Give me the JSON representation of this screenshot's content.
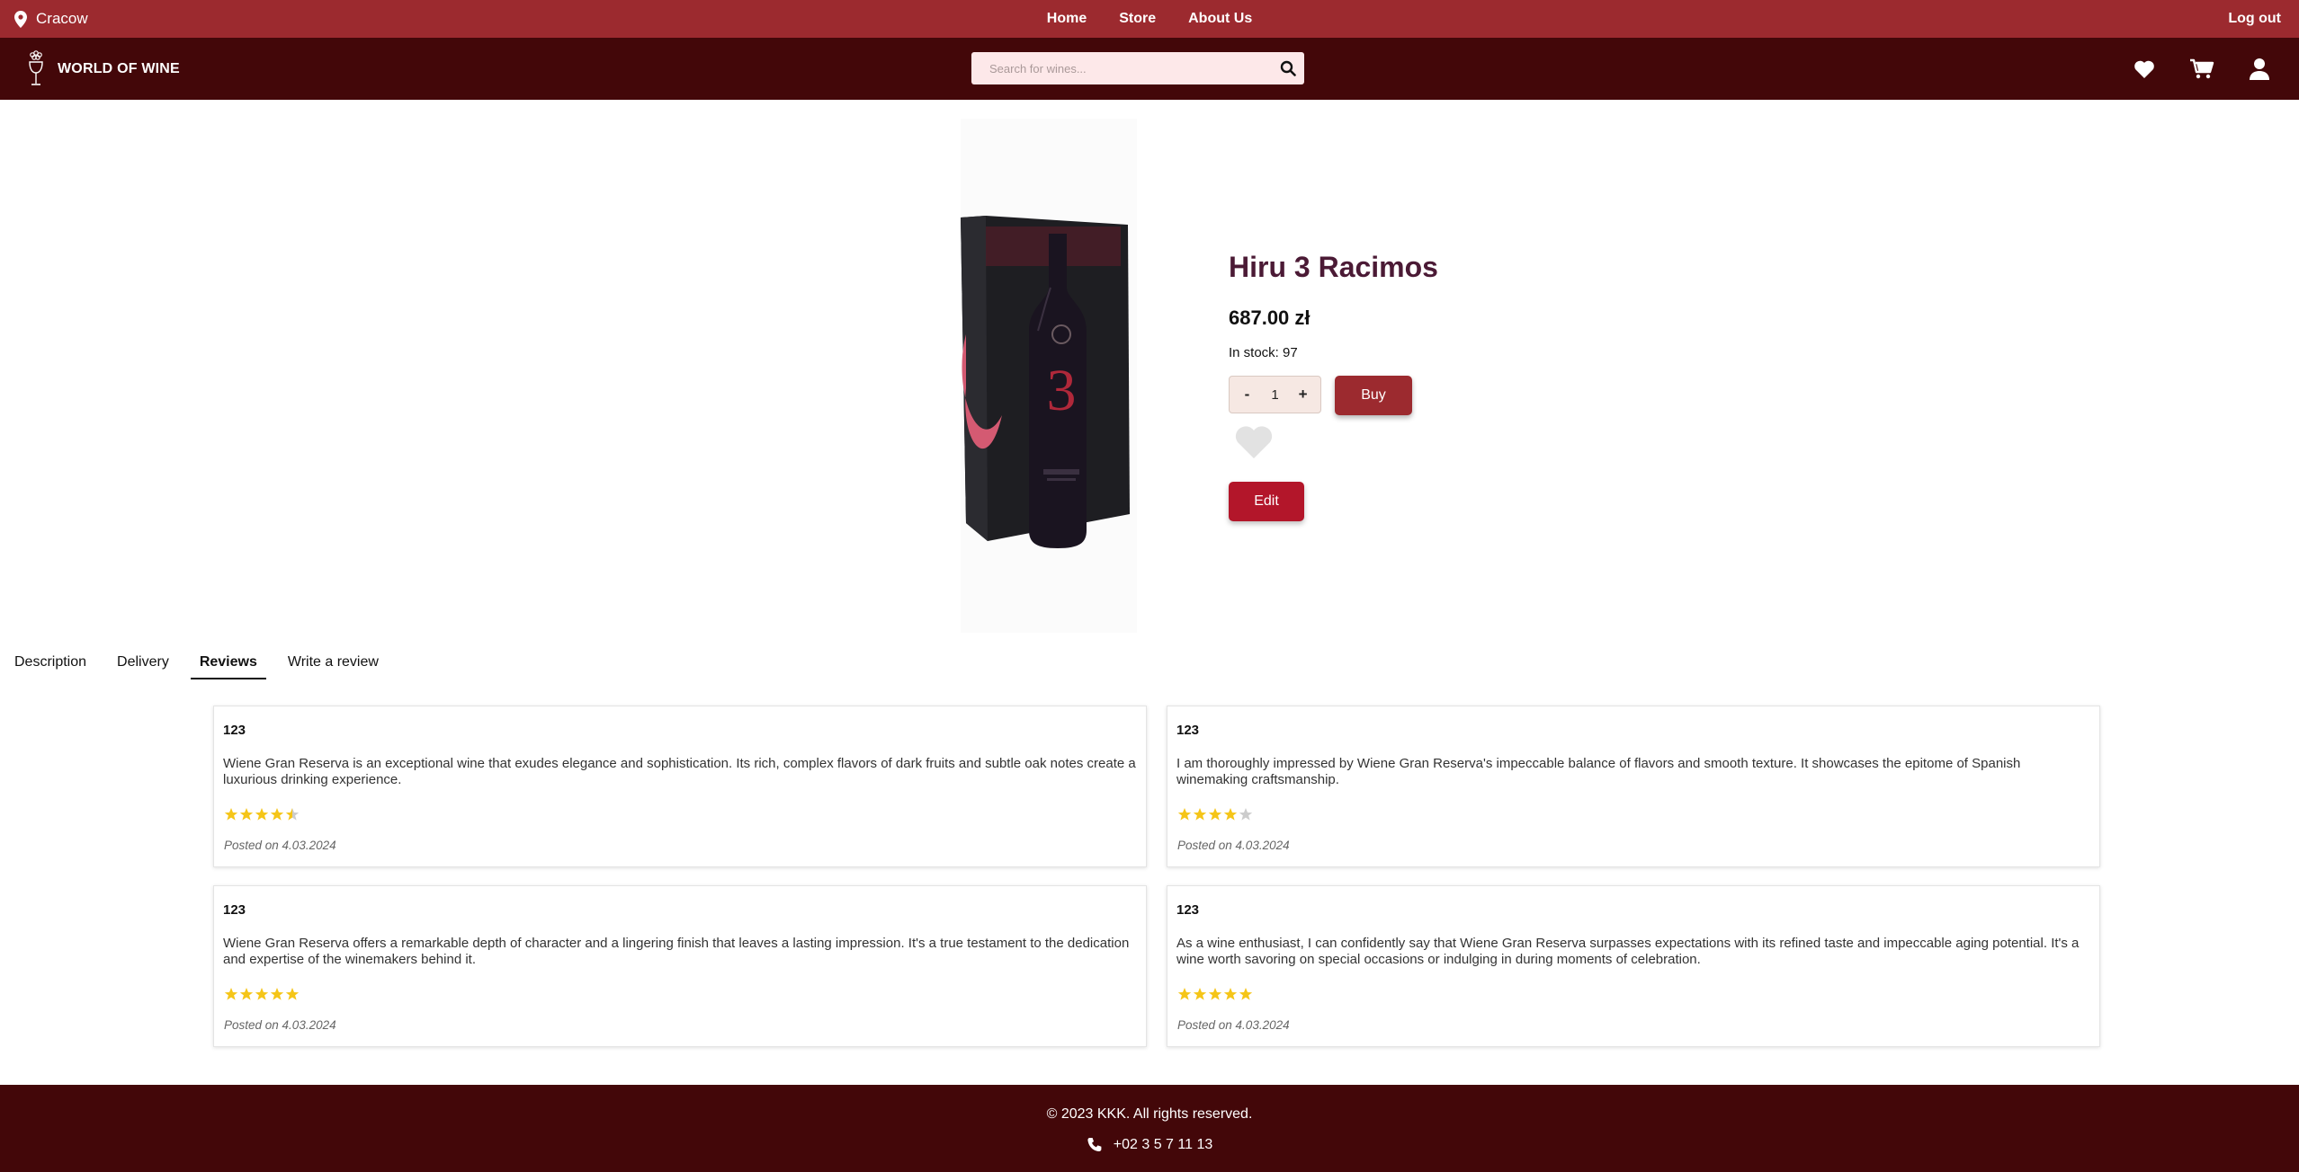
{
  "topbar": {
    "location": "Cracow",
    "location_icon": "map-pin-icon",
    "nav": [
      "Home",
      "Store",
      "About Us"
    ],
    "logout": "Log out",
    "color": "#9c2a2f"
  },
  "header": {
    "brand": "WORLD OF WINE",
    "search_placeholder": "Search for wines...",
    "icons": [
      "heart-icon",
      "cart-icon",
      "user-icon"
    ],
    "color": "#430709"
  },
  "product": {
    "name": "Hiru 3 Racimos",
    "price": "687.00 zł",
    "stock": "In stock: 97",
    "quantity": "1",
    "decrement": "-",
    "increment": "+",
    "buy_label": "Buy",
    "edit_label": "Edit"
  },
  "tabs": [
    {
      "label": "Description",
      "active": false
    },
    {
      "label": "Delivery",
      "active": false
    },
    {
      "label": "Reviews",
      "active": true
    },
    {
      "label": "Write a review",
      "active": false
    }
  ],
  "reviews": [
    {
      "author": "123",
      "text": "Wiene Gran Reserva is an exceptional wine that exudes elegance and sophistication. Its rich, complex flavors of dark fruits and subtle oak notes create a luxurious drinking experience.",
      "rating": 4.5,
      "date": "Posted on 4.03.2024"
    },
    {
      "author": "123",
      "text": "I am thoroughly impressed by Wiene Gran Reserva's impeccable balance of flavors and smooth texture. It showcases the epitome of Spanish winemaking craftsmanship.",
      "rating": 4,
      "date": "Posted on 4.03.2024"
    },
    {
      "author": "123",
      "text": "Wiene Gran Reserva offers a remarkable depth of character and a lingering finish that leaves a lasting impression. It's a true testament to the dedication and expertise of the winemakers behind it.",
      "rating": 5,
      "date": "Posted on 4.03.2024"
    },
    {
      "author": "123",
      "text": "As a wine enthusiast, I can confidently say that Wiene Gran Reserva surpasses expectations with its refined taste and impeccable aging potential. It's a wine worth savoring on special occasions or indulging in during moments of celebration.",
      "rating": 5,
      "date": "Posted on 4.03.2024"
    }
  ],
  "footer": {
    "copyright": "© 2023 KKK. All rights reserved.",
    "phone": "+02 3 5 7 11 13"
  },
  "colors": {
    "star": "#f5c518",
    "star_empty": "#cccccc",
    "title": "#4b1a35"
  }
}
